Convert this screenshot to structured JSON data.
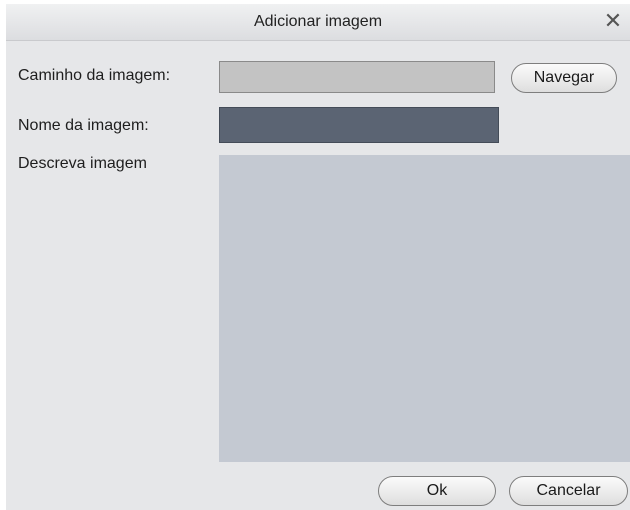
{
  "dialog": {
    "title": "Adicionar imagem",
    "close_symbol": "✕"
  },
  "form": {
    "path_label": "Caminho da imagem:",
    "path_value": "",
    "browse_label": "Navegar",
    "name_label": "Nome da imagem:",
    "name_value": "",
    "description_label": "Descreva imagem",
    "description_value": ""
  },
  "footer": {
    "ok_label": "Ok",
    "cancel_label": "Cancelar"
  },
  "colors": {
    "dialog_bg": "#e6e7e9",
    "name_field_bg": "#5b6473",
    "path_field_bg": "#c3c3c3",
    "description_bg": "#c4c9d2"
  },
  "icons": {
    "close": "close-icon"
  }
}
